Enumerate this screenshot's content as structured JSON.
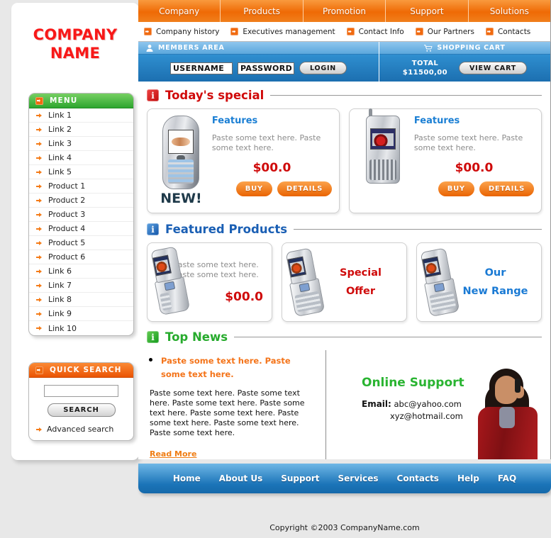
{
  "brand": {
    "line1": "COMPANY",
    "line2": "NAME",
    "color": "#f81818"
  },
  "topnav": [
    {
      "label": "Company"
    },
    {
      "label": "Products"
    },
    {
      "label": "Promotion"
    },
    {
      "label": "Support"
    },
    {
      "label": "Solutions"
    }
  ],
  "subnav": [
    {
      "label": "Company history"
    },
    {
      "label": "Executives management"
    },
    {
      "label": "Contact Info"
    },
    {
      "label": "Our Partners"
    },
    {
      "label": "Contacts"
    }
  ],
  "members": {
    "heading": "MEMBERS AREA",
    "username_value": "USERNAME",
    "password_value": "PASSWORD",
    "login_label": "LOGIN"
  },
  "cart": {
    "heading": "SHOPPING CART",
    "total_label": "TOTAL",
    "total_value": "$11500,00",
    "view_label": "VIEW CART"
  },
  "menu": {
    "heading": "MENU",
    "items": [
      {
        "label": "Link 1"
      },
      {
        "label": "Link 2"
      },
      {
        "label": "Link 3"
      },
      {
        "label": "Link 4"
      },
      {
        "label": "Link 5"
      },
      {
        "label": "Product 1"
      },
      {
        "label": "Product 2"
      },
      {
        "label": "Product 3"
      },
      {
        "label": "Product 4"
      },
      {
        "label": "Product 5"
      },
      {
        "label": "Product 6"
      },
      {
        "label": "Link 6"
      },
      {
        "label": "Link 7"
      },
      {
        "label": "Link 8"
      },
      {
        "label": "Link 9"
      },
      {
        "label": "Link 10"
      }
    ]
  },
  "quick_search": {
    "heading": "QUICK SEARCH",
    "input_value": "",
    "input_placeholder": "",
    "button_label": "SEARCH",
    "advanced_label": "Advanced search"
  },
  "todays_special": {
    "title": "Today's special",
    "title_color": "#d00a0a",
    "cards": [
      {
        "features_title": "Features",
        "text": "Paste some text here. Paste some text here.",
        "price": "$00.0",
        "buy_label": "BUY",
        "details_label": "DETAILS",
        "badge": "NEW!"
      },
      {
        "features_title": "Features",
        "text": "Paste some text here. Paste some text here.",
        "price": "$00.0",
        "buy_label": "BUY",
        "details_label": "DETAILS",
        "badge": ""
      }
    ]
  },
  "featured_products": {
    "title": "Featured Products",
    "title_color": "#1a5fb4",
    "cards": [
      {
        "text": "Paste some text here. Paste some text here.",
        "price": "$00.0"
      },
      {
        "headline_1": "Special",
        "headline_2": "Offer",
        "color": "#cf0a0a"
      },
      {
        "headline_1": "Our",
        "headline_2": "New Range",
        "color": "#1a7ad4"
      }
    ]
  },
  "top_news": {
    "title": "Top News",
    "title_color": "#27ab2d",
    "highlight": "Paste some text here. Paste some text here.",
    "body": "Paste some text here. Paste some text here. Paste some text here. Paste some text here. Paste some text here. Paste some text here. Paste some text here. Paste some text here.",
    "read_more": "Read More"
  },
  "online_support": {
    "title": "Online Support",
    "email_label": "Email:",
    "email_1": "abc@yahoo.com",
    "email_2": "xyz@hotmail.com"
  },
  "footernav": [
    {
      "label": "Home"
    },
    {
      "label": "About Us"
    },
    {
      "label": "Support"
    },
    {
      "label": "Services"
    },
    {
      "label": "Contacts"
    },
    {
      "label": "Help"
    },
    {
      "label": "FAQ"
    }
  ],
  "copyright": "Copyright ©2003 CompanyName.com"
}
